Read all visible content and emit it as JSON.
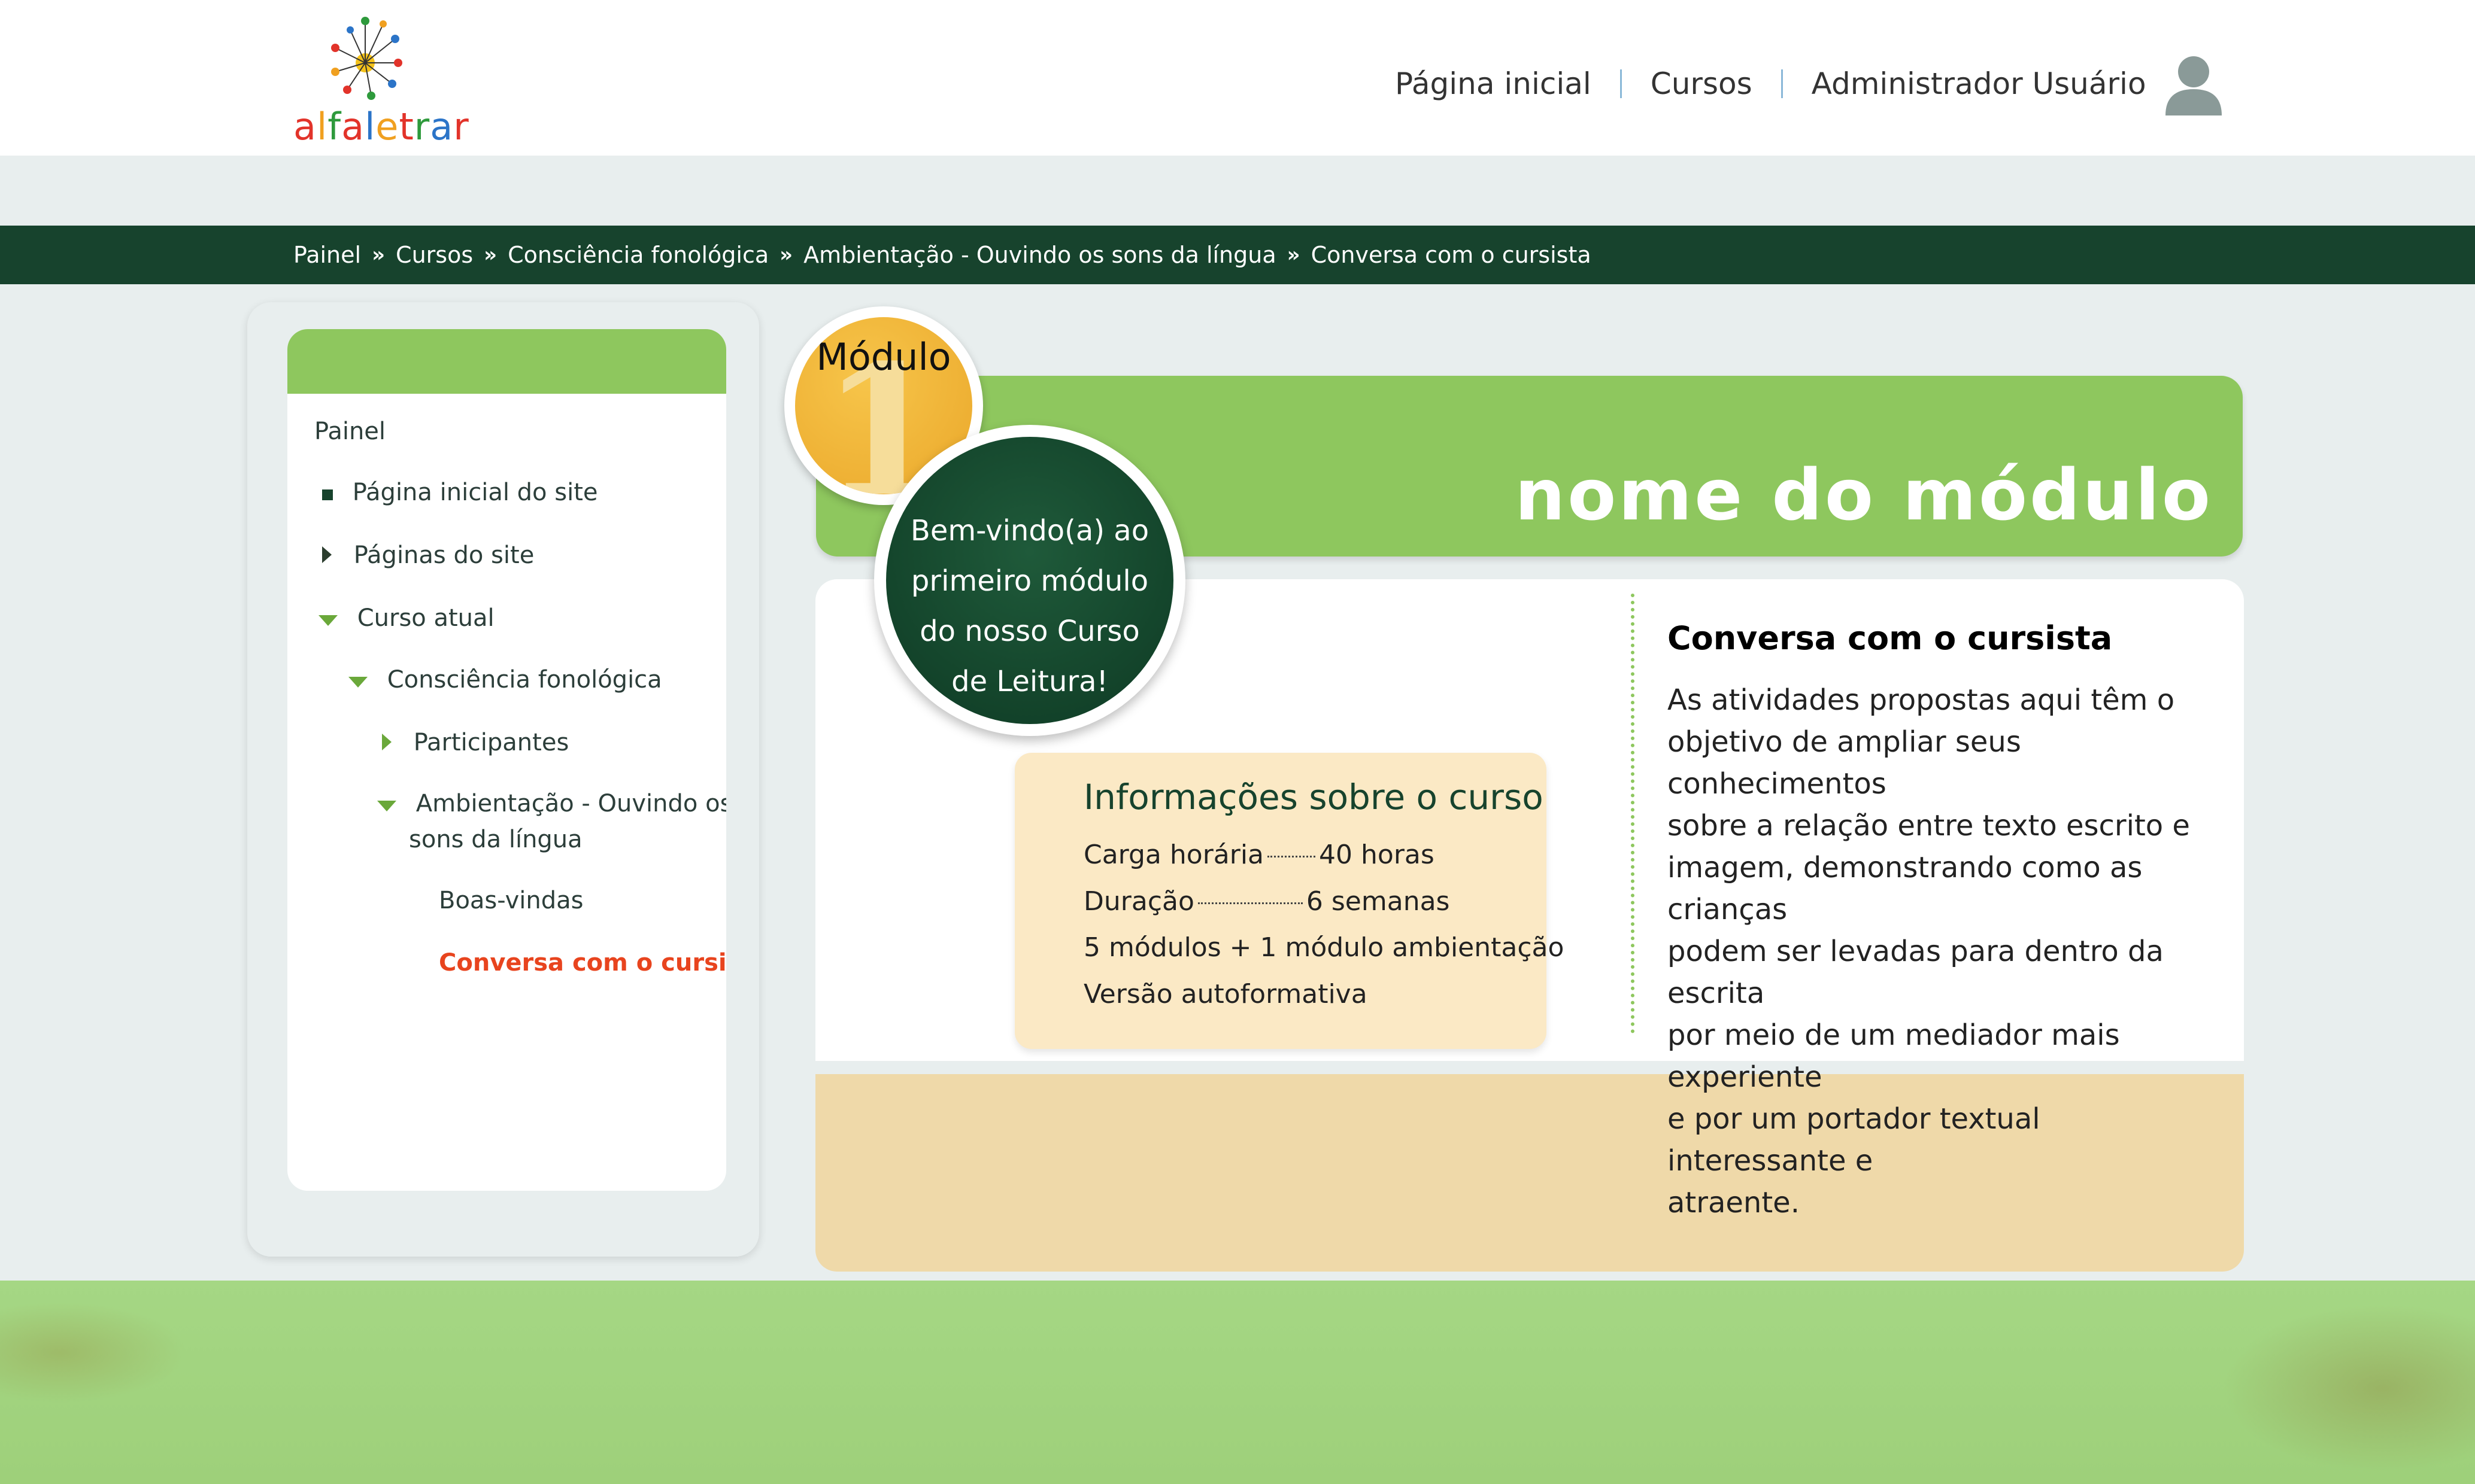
{
  "logo": {
    "text": "alfaletrar",
    "letter_colors": [
      "#e2332a",
      "#f0a020",
      "#2e9a3c",
      "#e2332a",
      "#2b74c8",
      "#f0a020",
      "#e2332a",
      "#2e9a3c",
      "#2b74c8",
      "#e2332a"
    ]
  },
  "topnav": {
    "home": "Página inicial",
    "courses": "Cursos",
    "user": "Administrador Usuário"
  },
  "breadcrumb": [
    "Painel",
    "Cursos",
    "Consciência fonológica",
    "Ambientação - Ouvindo os sons da língua",
    "Conversa com o cursista"
  ],
  "sidebar": {
    "painel": "Painel",
    "items": [
      {
        "label": "Página inicial do site",
        "icon": "square-bullet-icon"
      },
      {
        "label": "Páginas do site",
        "icon": "triangle-right-icon"
      },
      {
        "label": "Curso atual",
        "icon": "triangle-down-icon"
      },
      {
        "label": "Consciência fonológica",
        "icon": "triangle-down-icon"
      },
      {
        "label": "Participantes",
        "icon": "triangle-right-icon"
      },
      {
        "label_line1": "Ambientação - Ouvindo os",
        "label_line2": "sons da língua",
        "icon": "triangle-down-icon"
      },
      {
        "label": "Boas-vindas"
      },
      {
        "label": "Conversa com o cursista",
        "active": true,
        "color": "#e8441e"
      }
    ]
  },
  "module": {
    "label": "Módulo",
    "number": "1",
    "title": "nome do módulo"
  },
  "welcome": {
    "line1": "Bem-vindo(a) ao",
    "line2": "primeiro módulo",
    "line3": "do nosso Curso",
    "line4": "de Leitura!"
  },
  "info": {
    "title": "Informações sobre o curso",
    "carga_label": "Carga horária",
    "carga_value": "40 horas",
    "duracao_label": "Duração",
    "duracao_value": "6 semanas",
    "modulos": "5 módulos + 1 módulo ambientação",
    "versao": "Versão autoformativa"
  },
  "conversa": {
    "title": "Conversa com o cursista",
    "lines": [
      "As atividades propostas aqui têm o",
      "objetivo de ampliar seus conhecimentos",
      "sobre a relação entre texto escrito e",
      "imagem, demonstrando como as crianças",
      "podem ser levadas para dentro da escrita",
      "por meio de um mediador mais experiente",
      "e por um portador textual interessante e",
      "atraente."
    ]
  },
  "colors": {
    "green_dark": "#17432d",
    "green_light": "#8ec75e",
    "tan": "#efd9a9",
    "active_link": "#e8441e"
  }
}
